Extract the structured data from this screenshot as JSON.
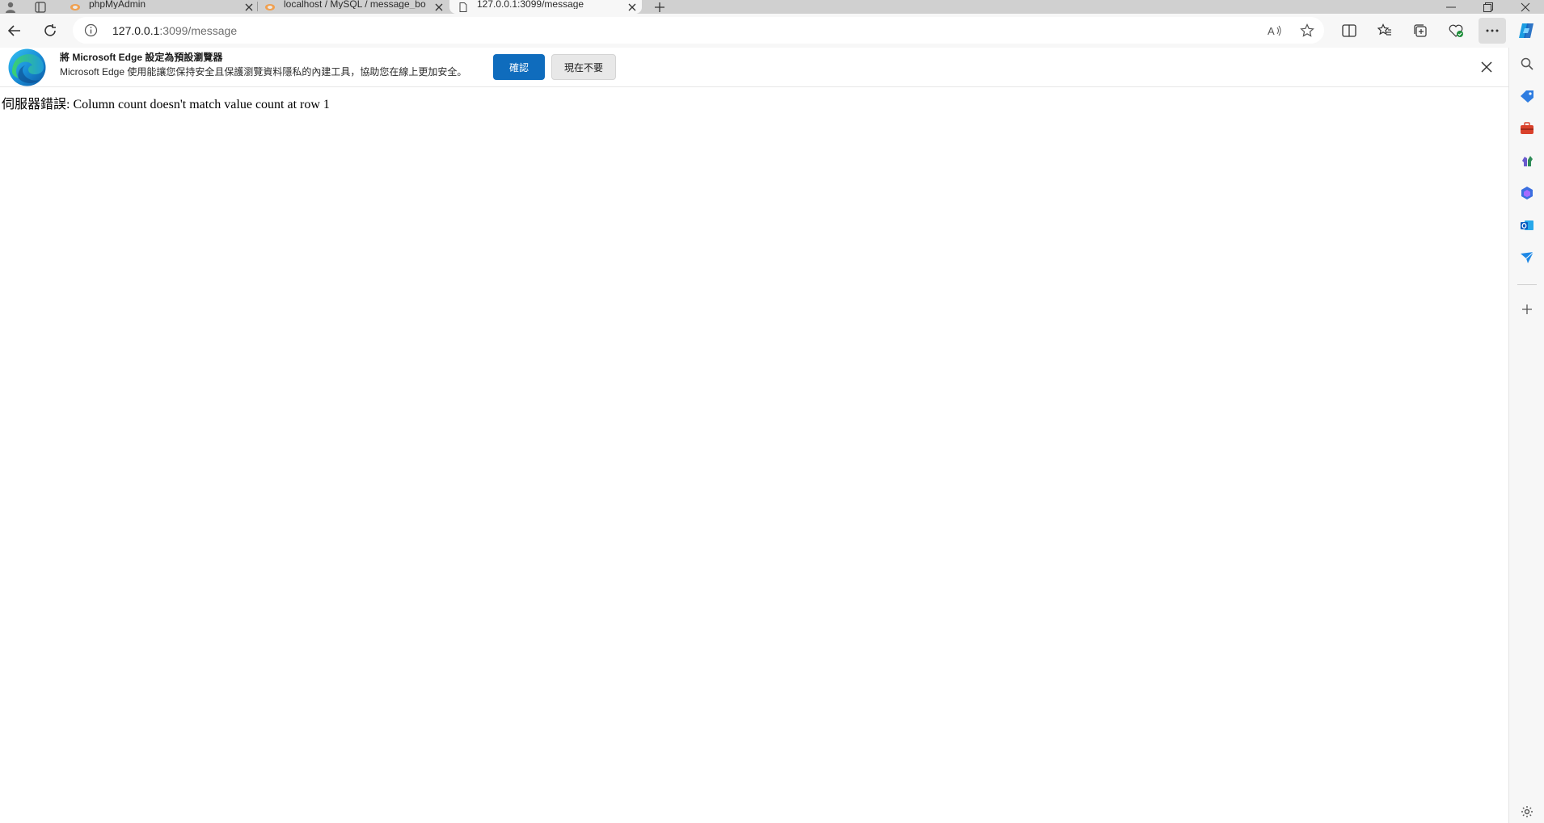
{
  "tabs": [
    {
      "title": "phpMyAdmin",
      "favicon": "phpmyadmin-icon",
      "active": false
    },
    {
      "title": "localhost / MySQL / message_bo",
      "favicon": "phpmyadmin-icon",
      "active": false
    },
    {
      "title": "127.0.0.1:3099/message",
      "favicon": "page-icon",
      "active": true
    }
  ],
  "address": {
    "host": "127.0.0.1",
    "path": ":3099/message"
  },
  "infobar": {
    "title": "將 Microsoft Edge 設定為預設瀏覽器",
    "description": "Microsoft Edge 使用能讓您保持安全且保護瀏覽資料隱私的內建工具，協助您在線上更加安全。",
    "confirm_label": "確認",
    "later_label": "現在不要"
  },
  "page": {
    "error_text": "伺服器錯誤: Column count doesn't match value count at row 1"
  },
  "colors": {
    "accent": "#0f6cbd",
    "tabstrip": "#d0d0d0",
    "toolbar": "#f7f7f7"
  }
}
